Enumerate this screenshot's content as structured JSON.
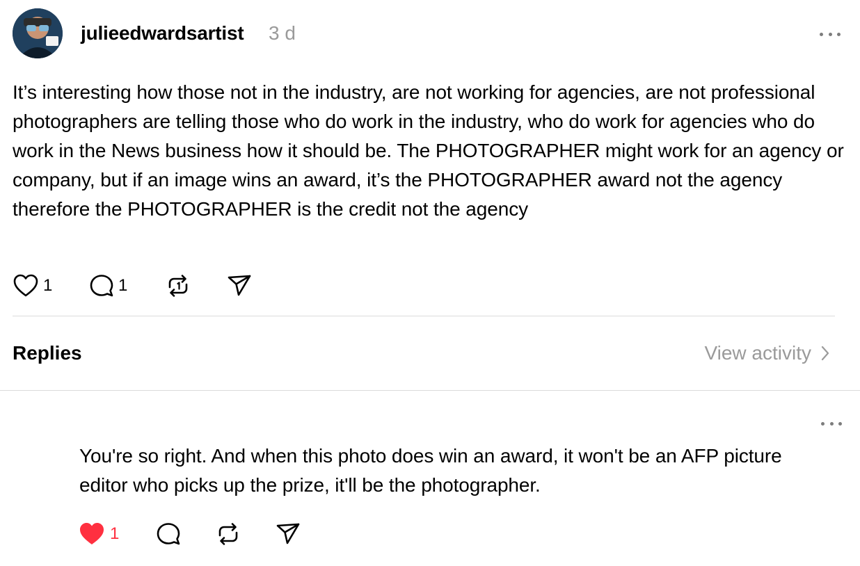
{
  "post": {
    "username": "julieedwardsartist",
    "timestamp": "3 d",
    "body": "It’s interesting how those not in the industry, are not working for agencies, are not professional photographers are telling those who do work in the industry, who do work for agencies who do work in the News business how it should be. The PHOTOGRAPHER might work for an agency or company, but if an image wins an award, it’s the PHOTOGRAPHER award not the agency therefore the PHOTOGRAPHER is the credit not the agency",
    "likes": "1",
    "comments": "1",
    "icons": [
      "heart-icon",
      "comment-icon",
      "repost-icon",
      "share-icon",
      "more-icon"
    ]
  },
  "replies_section": {
    "title": "Replies",
    "view_activity": "View activity"
  },
  "reply": {
    "body": "You're so right. And when this photo does win an award, it won't be an AFP picture editor who picks up the prize, it'll be the photographer.",
    "likes": "1",
    "liked": true,
    "like_color": "#ff3040"
  },
  "colors": {
    "text": "#000000",
    "muted": "#9a9a9a",
    "divider": "#dbdbdb",
    "accent_like": "#ff3040"
  }
}
